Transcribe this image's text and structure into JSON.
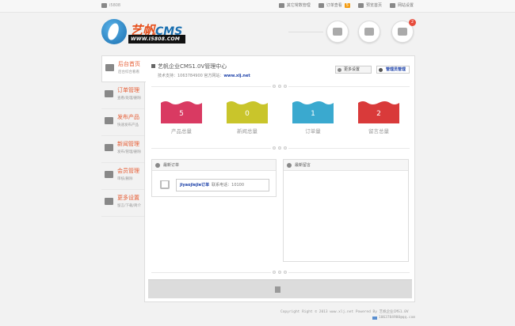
{
  "topbar": {
    "site": "i5808",
    "links": [
      {
        "label": "其它常数管理",
        "icon": "document-icon"
      },
      {
        "label": "订单查看",
        "icon": "mail-icon",
        "badge": "5"
      },
      {
        "label": "预览首页",
        "icon": "cloud-icon"
      },
      {
        "label": "网站设置",
        "icon": "sliders-icon"
      }
    ]
  },
  "logo": {
    "brand": "艺帆",
    "cms": "CMS",
    "url": "WWW.I5808.COM"
  },
  "header_buttons": [
    {
      "icon": "users-icon"
    },
    {
      "icon": "truck-icon"
    },
    {
      "icon": "chat-icon",
      "badge": "2"
    }
  ],
  "sidebar": {
    "items": [
      {
        "title": "后台首页",
        "sub": "后台综合看看",
        "icon": "home-icon"
      },
      {
        "title": "订单管理",
        "sub": "查看/处理/删除",
        "icon": "mail-icon"
      },
      {
        "title": "发布产品",
        "sub": "快速发布产品",
        "icon": "edit-icon"
      },
      {
        "title": "新闻管理",
        "sub": "发布/管理/删除",
        "icon": "news-icon"
      },
      {
        "title": "会员管理",
        "sub": "审核/删除",
        "icon": "members-icon"
      },
      {
        "title": "更多设置",
        "sub": "留言/下载/简介",
        "icon": "chart-icon"
      }
    ]
  },
  "welcome": {
    "title": "艺帆企业CMS1.0V管理中心",
    "support_label": "技术支持：1063784900 官方网站：",
    "site": "www.xlj.net"
  },
  "buttons": {
    "more": "更多设置",
    "admin": "管理员管理"
  },
  "stats": [
    {
      "value": "5",
      "label": "产品总量",
      "color": "#d93a62"
    },
    {
      "value": "0",
      "label": "新闻总量",
      "color": "#c9c52b"
    },
    {
      "value": "1",
      "label": "订单量",
      "color": "#3aa9cf"
    },
    {
      "value": "2",
      "label": "留言总量",
      "color": "#d93a3a"
    }
  ],
  "panels": {
    "orders": {
      "title": "最新订单",
      "order_name": "jiyaojiejie订单",
      "order_phone": "联系电话：10100"
    },
    "messages": {
      "title": "最新留言"
    }
  },
  "footer": {
    "copyright": "Copyright Right © 2013 www.xlj.net Powered By 艺帆企业CMS1.0V",
    "email": "1063784900@qq.com"
  }
}
